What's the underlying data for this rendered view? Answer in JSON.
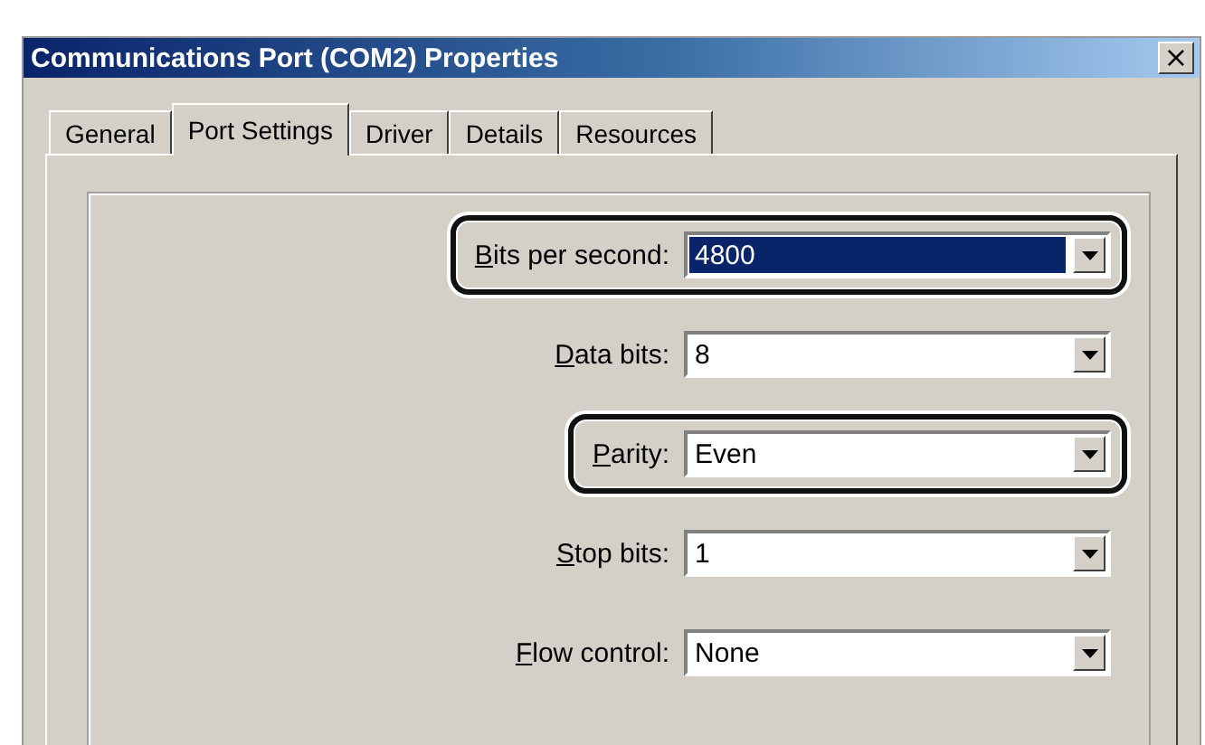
{
  "window": {
    "title": "Communications Port (COM2) Properties",
    "close_glyph": "×"
  },
  "tabs": [
    {
      "label": "General",
      "selected": false
    },
    {
      "label": "Port Settings",
      "selected": true
    },
    {
      "label": "Driver",
      "selected": false
    },
    {
      "label": "Details",
      "selected": false
    },
    {
      "label": "Resources",
      "selected": false
    }
  ],
  "fields": [
    {
      "label": "Bits per second:",
      "value": "4800",
      "focused": true,
      "highlighted": true
    },
    {
      "label": "Data bits:",
      "value": "8",
      "focused": false,
      "highlighted": false
    },
    {
      "label": "Parity:",
      "value": "Even",
      "focused": false,
      "highlighted": true
    },
    {
      "label": "Stop bits:",
      "value": "1",
      "focused": false,
      "highlighted": false
    },
    {
      "label": "Flow control:",
      "value": "None",
      "focused": false,
      "highlighted": false
    }
  ]
}
